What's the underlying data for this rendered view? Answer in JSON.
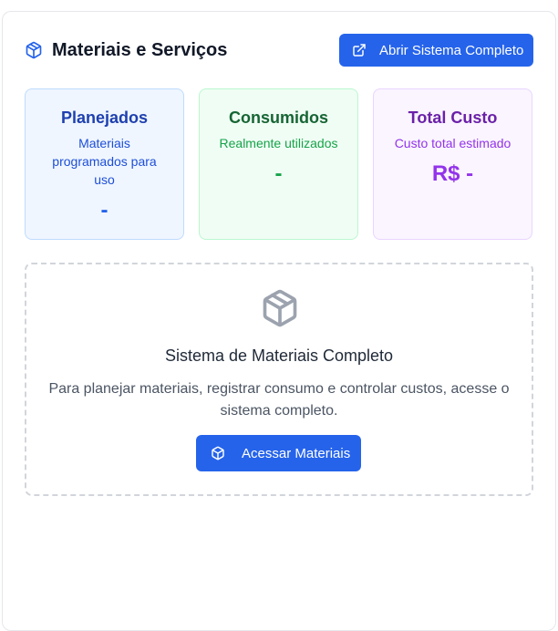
{
  "header": {
    "title": "Materiais e Serviços",
    "title_icon": "package-icon",
    "open_button_label": "Abrir Sistema Completo",
    "open_button_icon": "external-link-icon"
  },
  "cards": {
    "planned": {
      "title": "Planejados",
      "subtitle": "Materiais programados para uso",
      "value": "-"
    },
    "consumed": {
      "title": "Consumidos",
      "subtitle": "Realmente utilizados",
      "value": "-"
    },
    "total": {
      "title": "Total Custo",
      "subtitle": "Custo total estimado",
      "value": "R$ -"
    }
  },
  "empty_state": {
    "icon": "package-icon",
    "title": "Sistema de Materiais Completo",
    "text": "Para planejar materiais, registrar consumo e controlar custos, acesse o sistema completo.",
    "button_label": "Acessar Materiais",
    "button_icon": "package-icon"
  },
  "colors": {
    "accent": "#2563eb",
    "blue_card_bg": "#eff6ff",
    "green_card_bg": "#f0fdf4",
    "purple_card_bg": "#faf5ff",
    "green_text": "#16a34a",
    "purple_text": "#9333ea"
  }
}
